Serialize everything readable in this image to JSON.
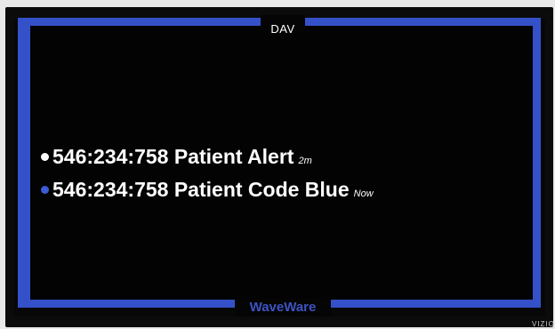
{
  "display": {
    "title": "DAV",
    "footer_brand": "WaveWare",
    "tv_brand": "VIZIO",
    "frame_color": "#3451c9"
  },
  "alerts": [
    {
      "id": "546:234:758",
      "message": "Patient Alert",
      "time": "2m",
      "dot_color": "white"
    },
    {
      "id": "546:234:758",
      "message": "Patient Code Blue",
      "time": "Now",
      "dot_color": "blue"
    }
  ]
}
